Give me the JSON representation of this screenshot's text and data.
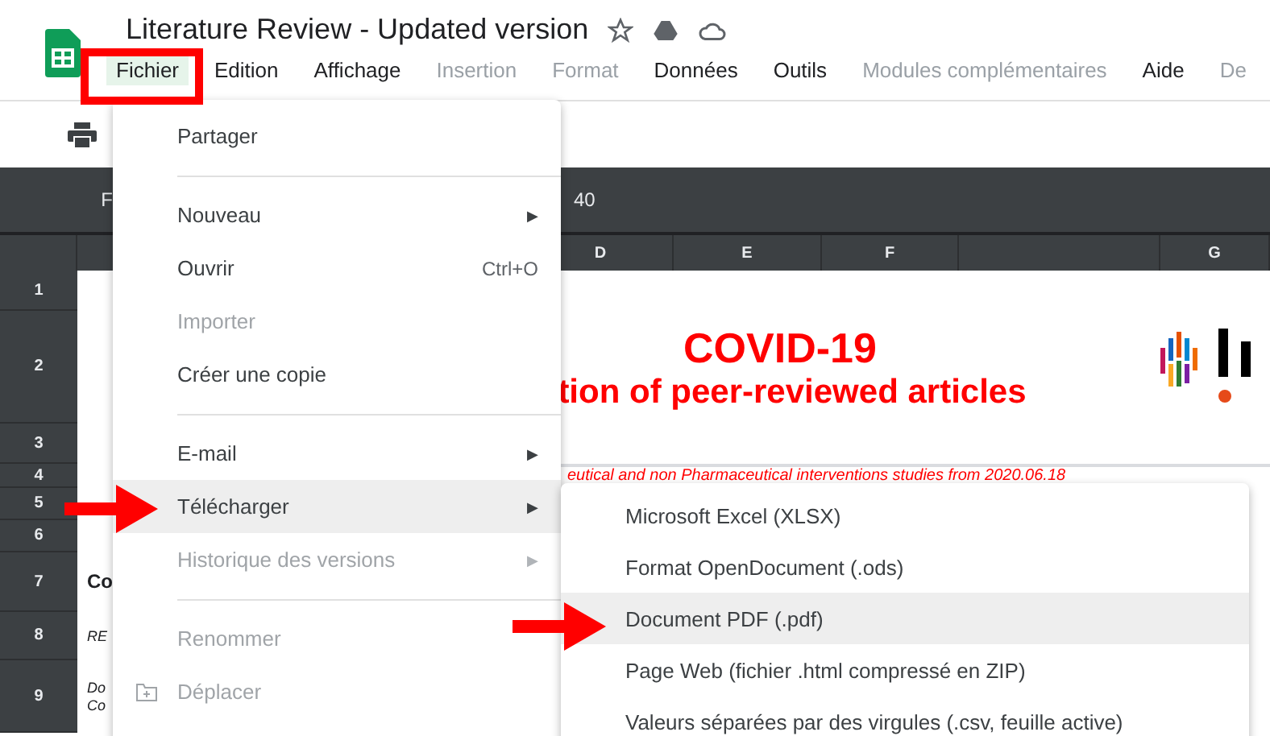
{
  "document": {
    "title": "Literature Review - Updated version"
  },
  "menu_bar": [
    {
      "label": "Fichier",
      "selected": true,
      "disabled": false
    },
    {
      "label": "Edition",
      "selected": false,
      "disabled": false
    },
    {
      "label": "Affichage",
      "selected": false,
      "disabled": false
    },
    {
      "label": "Insertion",
      "selected": false,
      "disabled": true
    },
    {
      "label": "Format",
      "selected": false,
      "disabled": true
    },
    {
      "label": "Données",
      "selected": false,
      "disabled": false
    },
    {
      "label": "Outils",
      "selected": false,
      "disabled": false
    },
    {
      "label": "Modules complémentaires",
      "selected": false,
      "disabled": true
    },
    {
      "label": "Aide",
      "selected": false,
      "disabled": false
    },
    {
      "label": "De",
      "selected": false,
      "disabled": true
    }
  ],
  "formula_bar": {
    "name_box": "F",
    "content": "40"
  },
  "columns": [
    "D",
    "E",
    "F",
    "G"
  ],
  "rows": [
    "1",
    "2",
    "3",
    "4",
    "5",
    "6",
    "7",
    "8",
    "9"
  ],
  "sheet": {
    "heading": "COVID-19",
    "subheading": "tion of peer-reviewed articles",
    "note": "eutical and non Pharmaceutical interventions studies from 2020.06.18",
    "column_a": [
      {
        "kind": "bold",
        "lines": [
          "Co"
        ]
      },
      {
        "kind": "italic",
        "lines": [
          "RE"
        ]
      },
      {
        "kind": "italic",
        "lines": [
          "Do",
          "Co"
        ]
      }
    ]
  },
  "file_menu": [
    {
      "kind": "item",
      "label": "Partager",
      "disabled": false,
      "selected": false
    },
    {
      "kind": "divider"
    },
    {
      "kind": "item",
      "label": "Nouveau",
      "disabled": false,
      "submenu": "▶",
      "selected": false
    },
    {
      "kind": "item",
      "label": "Ouvrir",
      "shortcut": "Ctrl+O",
      "disabled": false,
      "selected": false
    },
    {
      "kind": "item",
      "label": "Importer",
      "disabled": true,
      "selected": false
    },
    {
      "kind": "item",
      "label": "Créer une copie",
      "disabled": false,
      "selected": false
    },
    {
      "kind": "divider"
    },
    {
      "kind": "item",
      "label": "E-mail",
      "disabled": false,
      "submenu": "▶",
      "selected": false
    },
    {
      "kind": "item",
      "label": "Télécharger",
      "disabled": false,
      "submenu": "▶",
      "selected": true
    },
    {
      "kind": "item",
      "label": "Historique des versions",
      "disabled": true,
      "submenu": "▶",
      "selected": false
    },
    {
      "kind": "divider"
    },
    {
      "kind": "item",
      "label": "Renommer",
      "disabled": true,
      "selected": false
    },
    {
      "kind": "folder_item",
      "label": "Déplacer",
      "disabled": true,
      "selected": false
    }
  ],
  "download_submenu": [
    {
      "label": "Microsoft Excel (XLSX)",
      "selected": false
    },
    {
      "label": "Format OpenDocument (.ods)",
      "selected": false
    },
    {
      "label": "Document PDF (.pdf)",
      "selected": true
    },
    {
      "label": "Page Web (fichier .html compressé en ZIP)",
      "selected": false
    },
    {
      "label": "Valeurs séparées par des virgules (.csv, feuille active)",
      "selected": false
    }
  ]
}
